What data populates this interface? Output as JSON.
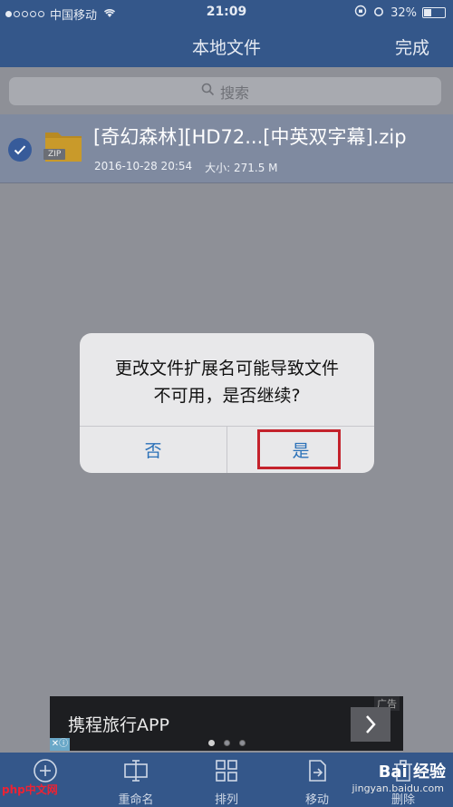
{
  "status": {
    "carrier": "中国移动",
    "time": "21:09",
    "battery": "32%",
    "battery_level": 0.32
  },
  "nav": {
    "title": "本地文件",
    "done": "完成"
  },
  "search": {
    "placeholder": "搜索"
  },
  "file": {
    "name": "[奇幻森林][HD72...[中英双字幕].zip",
    "zip_badge": "ZIP",
    "date": "2016-10-28 20:54",
    "size": "大小: 271.5 M"
  },
  "dialog": {
    "message_line1": "更改文件扩展名可能导致文件",
    "message_line2": "不可用，是否继续?",
    "no": "否",
    "yes": "是"
  },
  "ad": {
    "text": "携程旅行APP",
    "tag": "广告"
  },
  "toolbar": {
    "items": [
      {
        "label": ""
      },
      {
        "label": "重命名"
      },
      {
        "label": "排列"
      },
      {
        "label": "移动"
      },
      {
        "label": "删除"
      }
    ]
  },
  "watermarks": {
    "php": "php中文网",
    "baidu": "Bai 经验",
    "baidu_sub": "jingyan.baidu.com"
  },
  "colors": {
    "nav_bg": "#34578a",
    "dialog_button": "#2b71b8",
    "highlight": "#c4222c"
  }
}
